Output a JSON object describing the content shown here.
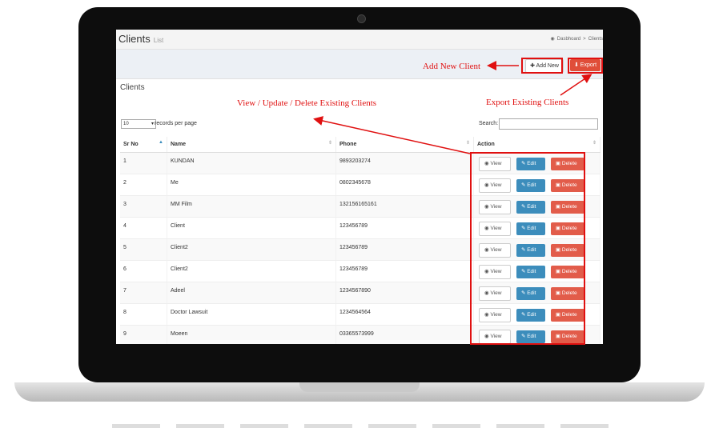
{
  "header": {
    "title": "Clients",
    "subtitle": "List",
    "breadcrumb_home": "Dasbhoard",
    "breadcrumb_sep": ">",
    "breadcrumb_current": "Clients"
  },
  "toolbar": {
    "add_label": "Add New",
    "export_label": "Export"
  },
  "box": {
    "title": "Clients"
  },
  "datatable": {
    "length_value": "10",
    "length_label": "records per page",
    "search_label": "Search:",
    "columns": [
      "Sr No",
      "Name",
      "Phone",
      "Action"
    ],
    "rows": [
      {
        "sr": "1",
        "name": "KUNDAN",
        "phone": "9893203274"
      },
      {
        "sr": "2",
        "name": "Me",
        "phone": "0802345678"
      },
      {
        "sr": "3",
        "name": "MM Film",
        "phone": "132156165161"
      },
      {
        "sr": "4",
        "name": "Client",
        "phone": "123456789"
      },
      {
        "sr": "5",
        "name": "Client2",
        "phone": "123456789"
      },
      {
        "sr": "6",
        "name": "Client2",
        "phone": "123456789"
      },
      {
        "sr": "7",
        "name": "Adeel",
        "phone": "1234567890"
      },
      {
        "sr": "8",
        "name": "Doctor Lawsuit",
        "phone": "1234564564"
      },
      {
        "sr": "9",
        "name": "Moeen",
        "phone": "03365573999"
      }
    ],
    "actions": {
      "view": "View",
      "edit": "Edit",
      "delete": "Delete"
    }
  },
  "annotations": {
    "add": "Add New Client",
    "export": "Export Existing Clients",
    "manage": "View / Update / Delete Existing Clients"
  },
  "colors": {
    "accent_red": "#e01010",
    "edit_blue": "#3c8dbc",
    "delete_red": "#e25c4a",
    "export_red": "#e04e39"
  }
}
